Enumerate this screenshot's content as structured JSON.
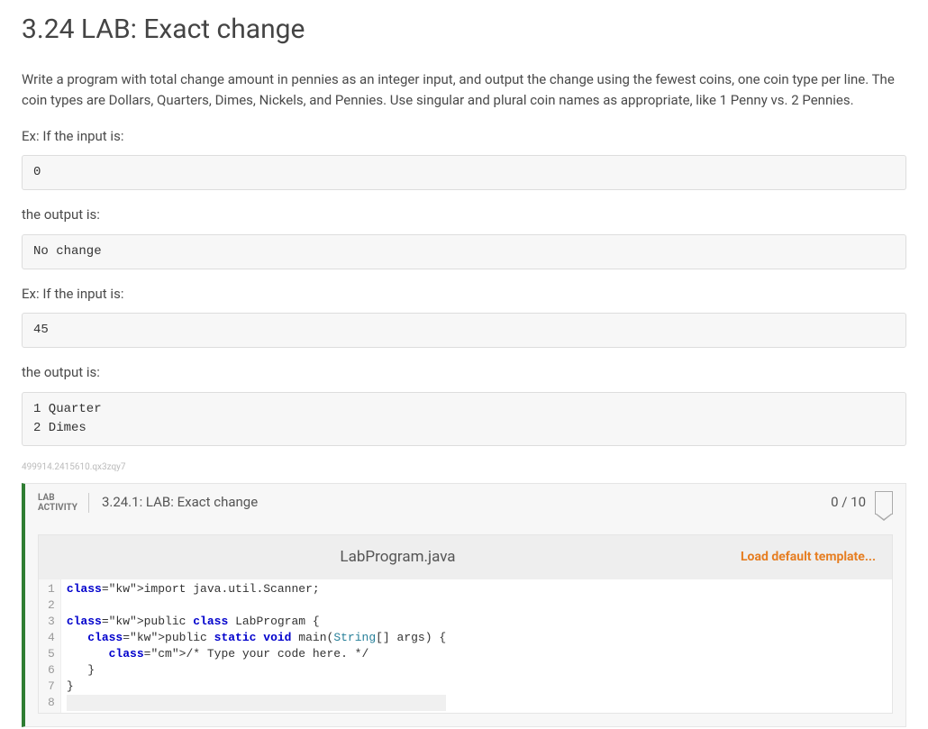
{
  "title": "3.24 LAB: Exact change",
  "description": "Write a program with total change amount in pennies as an integer input, and output the change using the fewest coins, one coin type per line. The coin types are Dollars, Quarters, Dimes, Nickels, and Pennies. Use singular and plural coin names as appropriate, like 1 Penny vs. 2 Pennies.",
  "ex1_label": "Ex: If the input is:",
  "ex1_input": "0",
  "out1_label": "the output is:",
  "ex1_output": "No change",
  "ex2_label": "Ex: If the input is:",
  "ex2_input": "45",
  "out2_label": "the output is:",
  "ex2_output": "1 Quarter\n2 Dimes",
  "ref_id": "499914.2415610.qx3zqy7",
  "lab": {
    "tag_line1": "LAB",
    "tag_line2": "ACTIVITY",
    "activity_title": "3.24.1: LAB: Exact change",
    "score": "0 / 10",
    "filename": "LabProgram.java",
    "load_template": "Load default template...",
    "code_lines": [
      "import java.util.Scanner;",
      "",
      "public class LabProgram {",
      "   public static void main(String[] args) {",
      "      /* Type your code here. */",
      "   }",
      "}",
      ""
    ]
  }
}
